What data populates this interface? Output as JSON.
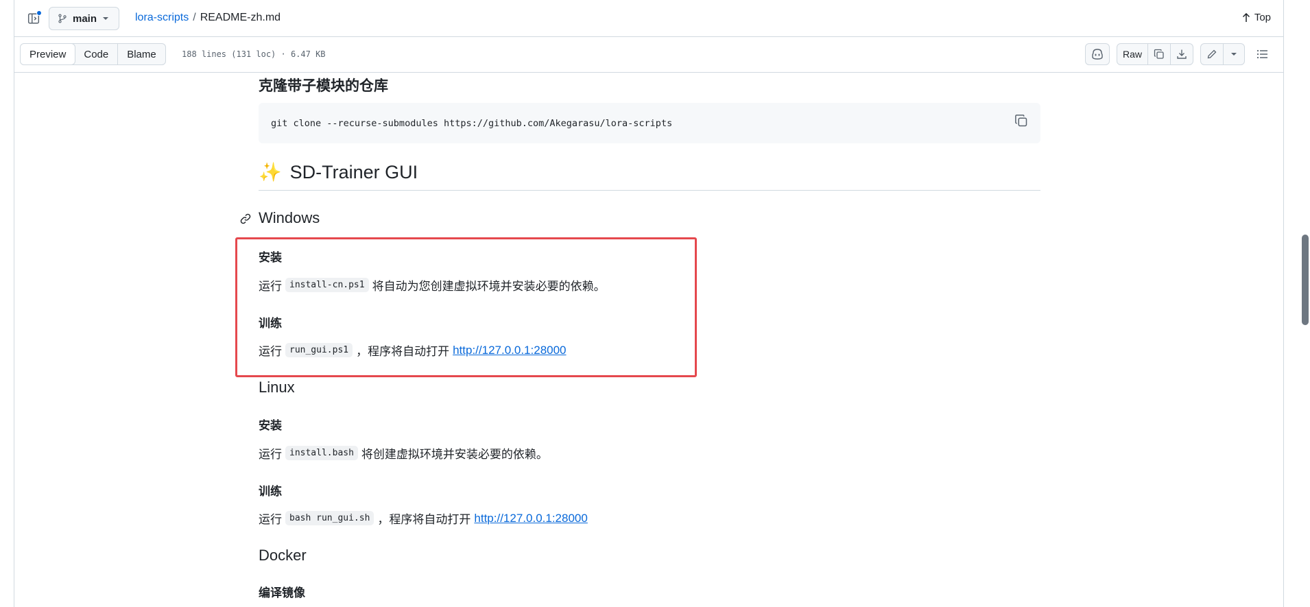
{
  "header": {
    "branch": "main",
    "repo": "lora-scripts",
    "separator": "/",
    "file": "README-zh.md",
    "top_label": "Top"
  },
  "toolbar": {
    "tabs": [
      "Preview",
      "Code",
      "Blame"
    ],
    "active_tab": "Preview",
    "meta": "188 lines (131 loc) · 6.47 KB",
    "raw_label": "Raw"
  },
  "content": {
    "clone_heading": "克隆带子模块的仓库",
    "clone_command": "git clone --recurse-submodules https://github.com/Akegarasu/lora-scripts",
    "gui_emoji": "✨",
    "gui_heading": "SD-Trainer GUI",
    "windows": {
      "heading": "Windows",
      "install_heading": "安装",
      "install_prefix": "运行",
      "install_code": "install-cn.ps1",
      "install_suffix": "将自动为您创建虚拟环境并安装必要的依赖。",
      "train_heading": "训练",
      "train_prefix": "运行",
      "train_code": "run_gui.ps1",
      "train_suffix": "，程序将自动打开",
      "train_link": "http://127.0.0.1:28000"
    },
    "linux": {
      "heading": "Linux",
      "install_heading": "安装",
      "install_prefix": "运行",
      "install_code": "install.bash",
      "install_suffix": "将创建虚拟环境并安装必要的依赖。",
      "train_heading": "训练",
      "train_prefix": "运行",
      "train_code": "bash run_gui.sh",
      "train_suffix": "，程序将自动打开",
      "train_link": "http://127.0.0.1:28000"
    },
    "docker": {
      "heading": "Docker",
      "build_heading": "编译镜像"
    }
  },
  "colors": {
    "accent": "#0969da",
    "highlight_box": "#e5484d",
    "border": "#d1d9e0"
  },
  "icons": [
    "sidebar-icon",
    "branch-icon",
    "caret-down-icon",
    "arrow-up-icon",
    "copilot-icon",
    "copy-icon",
    "download-icon",
    "pencil-icon",
    "list-icon",
    "link-icon"
  ]
}
